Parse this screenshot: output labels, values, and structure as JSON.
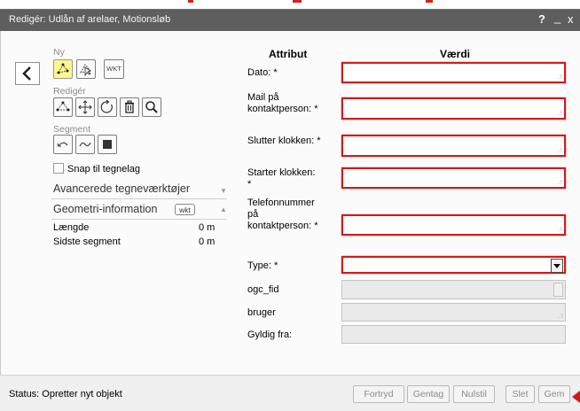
{
  "window": {
    "title": "Redigér: Udlån af arelaer, Motionsløb",
    "help_label": "?",
    "minimize_label": "_",
    "close_label": "x"
  },
  "tools": {
    "new_label": "Ny",
    "wkt_label": "WKT",
    "edit_label": "Redigér",
    "segment_label": "Segment",
    "snap_label": "Snap til tegnelag",
    "advanced_label": "Avancerede tegneværktøjer",
    "geometry_label": "Geometri-information",
    "geometry_badge": "wkt",
    "length_label": "Længde",
    "length_value": "0 m",
    "last_segment_label": "Sidste segment",
    "last_segment_value": "0 m"
  },
  "form": {
    "attribute_header": "Attribut",
    "value_header": "Værdi",
    "fields": [
      {
        "label": "Dato: *"
      },
      {
        "label": "Mail på kontaktperson: *"
      },
      {
        "label": "Slutter klokken: *"
      },
      {
        "label": "Starter klokken: *"
      },
      {
        "label": "Telefonnummer på kontaktperson: *"
      },
      {
        "label": "Type: *"
      },
      {
        "label": "ogc_fid"
      },
      {
        "label": "bruger"
      },
      {
        "label": "Gyldig fra:"
      }
    ]
  },
  "status": {
    "text": "Status: Opretter nyt objekt",
    "cancel_label": "Fortryd",
    "redo_label": "Gentag",
    "reset_label": "Nulstil",
    "delete_label": "Slet",
    "save_label": "Gem"
  }
}
